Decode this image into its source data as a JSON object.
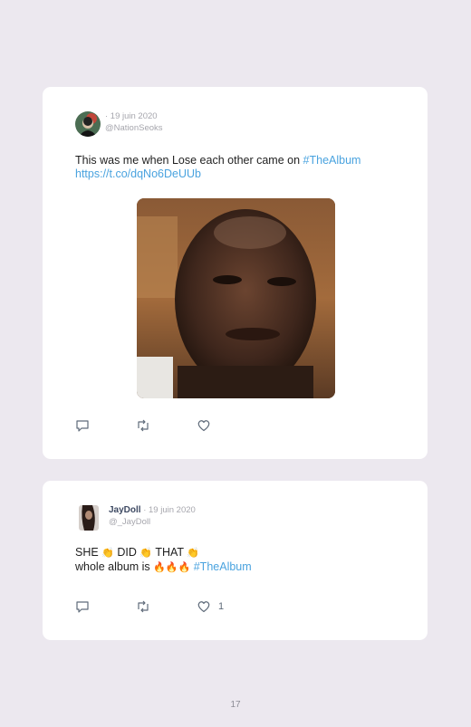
{
  "tweets": [
    {
      "date": "· 19 juin 2020",
      "handle": "@NationSeoks",
      "text_plain": "This was me when Lose each other came on ",
      "hashtag": "#TheAlbum",
      "link": "https://t.co/dqNo6DeUUb",
      "icons": [
        "reply-icon",
        "retweet-icon",
        "like-icon"
      ]
    },
    {
      "name": "JayDoll",
      "date": " · 19 juin 2020",
      "handle": "@_JayDoll",
      "line1_a": "SHE ",
      "line1_b": " DID ",
      "line1_c": " THAT ",
      "clap": "👏",
      "line2_a": "whole album is ",
      "fire": "🔥🔥🔥",
      "hashtag": "#TheAlbum",
      "like_count": "1",
      "icons": [
        "reply-icon",
        "retweet-icon",
        "like-icon"
      ]
    }
  ],
  "page_number": "17"
}
